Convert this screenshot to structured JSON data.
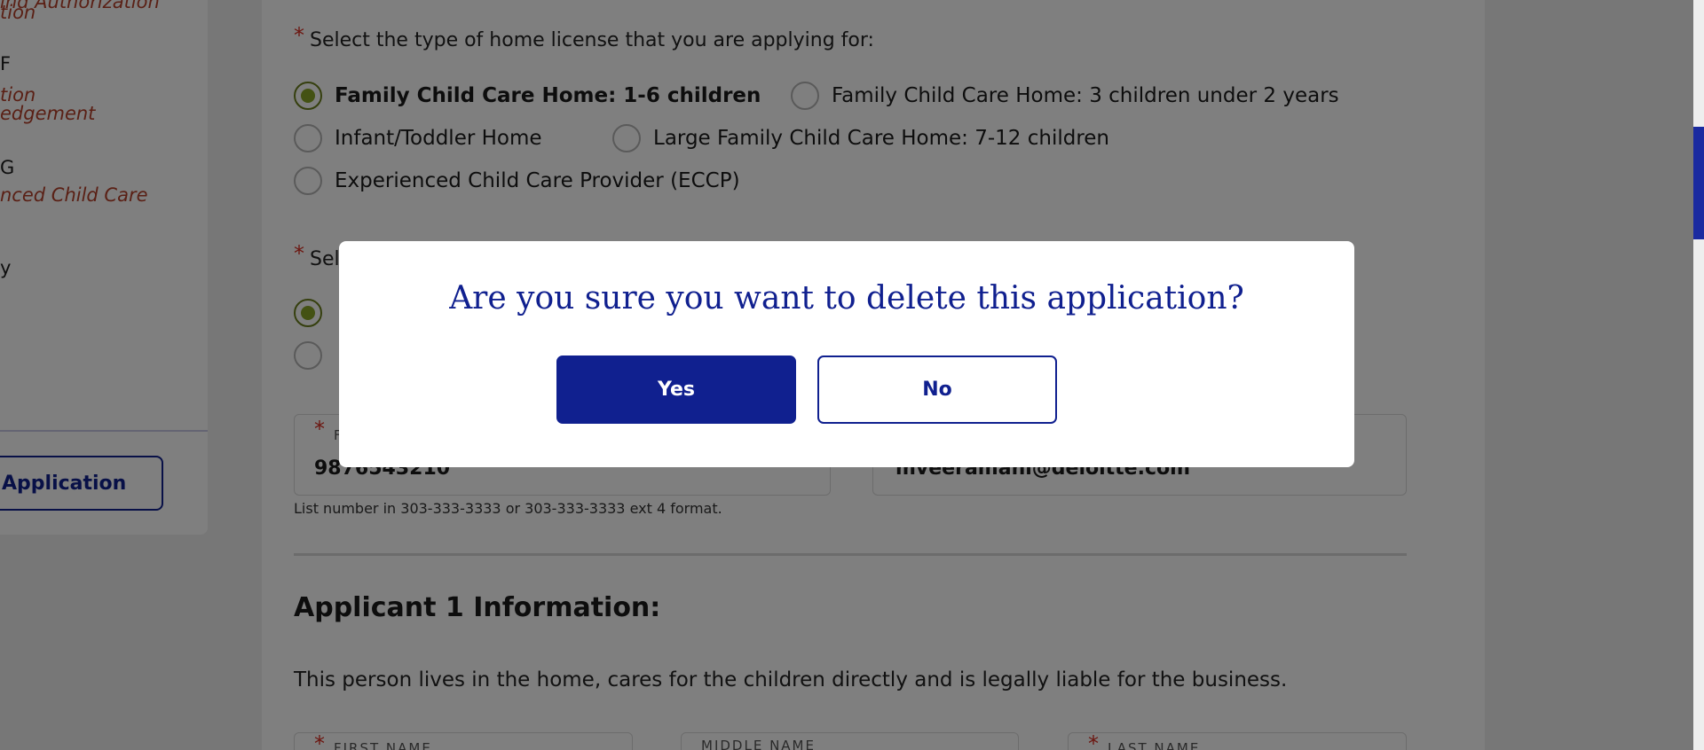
{
  "sidebar": {
    "lines": [
      {
        "text": "ind Authorization",
        "style": "sub"
      },
      {
        "text": "tion",
        "style": "sub"
      },
      {
        "text": "F",
        "style": "step"
      },
      {
        "text": "tion",
        "style": "sub"
      },
      {
        "text": "edgement",
        "style": "sub"
      },
      {
        "text": "G",
        "style": "step"
      },
      {
        "text": "nced Child Care",
        "style": "sub"
      },
      {
        "text": "y",
        "style": "step"
      }
    ],
    "application_button": "Application"
  },
  "license_type": {
    "required_mark": "*",
    "question": "Select the type of home license that you are applying for:",
    "options": [
      {
        "label": "Family Child Care Home: 1-6 children",
        "checked": true
      },
      {
        "label": "Family Child Care Home: 3 children under 2 years",
        "checked": false
      },
      {
        "label": "Infant/Toddler Home",
        "checked": false
      },
      {
        "label": "Large Family Child Care Home: 7-12 children",
        "checked": false
      },
      {
        "label": "Experienced Child Care Provider (ECCP)",
        "checked": false
      }
    ]
  },
  "second_question": {
    "required_mark": "*",
    "question_fragment": "Sel"
  },
  "contact": {
    "phone_required_mark": "*",
    "phone_label_fragment": "F",
    "phone_value": "9876543210",
    "email_value": "mveeramani@deloitte.com",
    "phone_hint": "List number in 303-333-3333 or 303-333-3333 ext 4 format."
  },
  "applicant": {
    "title": "Applicant 1 Information:",
    "description": "This person lives in the home, cares for the children directly and is legally liable for the business.",
    "first_name_label": "FIRST NAME",
    "middle_name_label": "MIDDLE NAME",
    "last_name_label": "LAST NAME",
    "required_mark": "*"
  },
  "modal": {
    "title": "Are you sure you want to delete this application?",
    "yes_label": "Yes",
    "no_label": "No"
  },
  "colors": {
    "brand_navy": "#10208f",
    "radio_green": "#88a526",
    "required_red": "#d92d20",
    "sidebar_sub_text": "#b5402a"
  }
}
